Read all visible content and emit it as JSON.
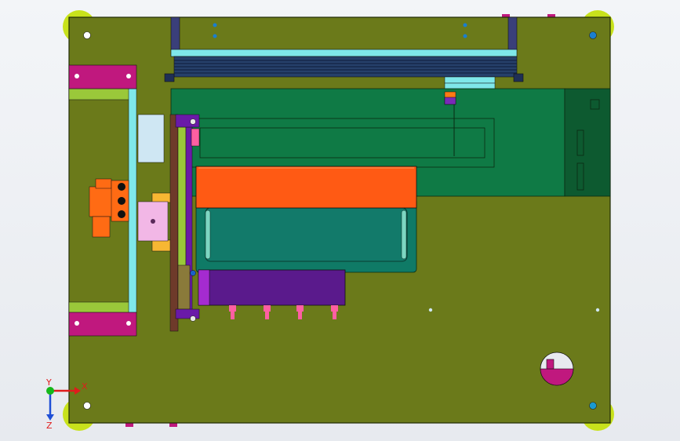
{
  "viewport": {
    "kind": "cad-3d-model-view",
    "orientation": "top"
  },
  "triad": {
    "x_label": "X",
    "y_label": "Y",
    "z_label": "Z"
  },
  "colors": {
    "base_plate": "#6b7a1a",
    "base_plate_edge": "#1f2a05",
    "green_panel": "#0f7a45",
    "dark_green_block": "#0d5a30",
    "orange_block": "#ff5a14",
    "teal_frame": "#0f7a66",
    "magenta_clamp": "#c0187e",
    "purple_block": "#5a1a8c",
    "corner_pad": "#c8e21c",
    "cyan_rail": "#7fe8ea",
    "steel_bar": "#26406a",
    "light_blue_block": "#cfe7f3",
    "pink_block": "#f2b7e6",
    "orange_bracket": "#ff6b14",
    "pink_pins": "#ff5fa2",
    "triad_x": "#e01c1c",
    "triad_y": "#15b81a",
    "triad_z": "#1f4fd6"
  },
  "model_parts": [
    "base-plate",
    "corner-pads",
    "top-rail-assembly",
    "green-panel",
    "dark-green-block",
    "orange-block",
    "teal-frame",
    "magenta-clamps",
    "left-slide-frame",
    "vertical-rail",
    "purple-block",
    "orange-bracket",
    "round-port",
    "mounting-holes"
  ]
}
